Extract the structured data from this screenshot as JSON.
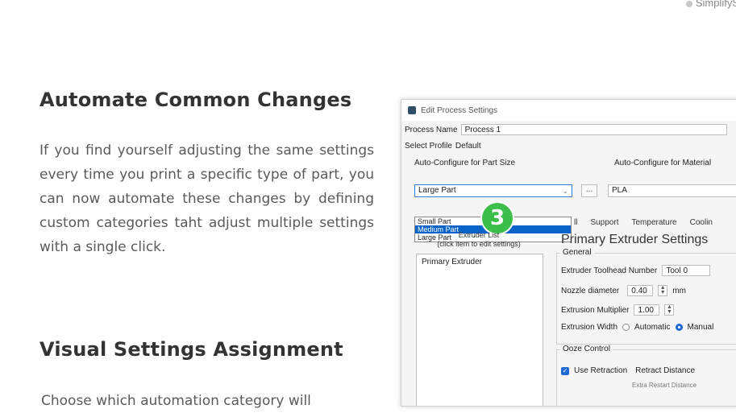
{
  "brand": {
    "text": "SimplifyS"
  },
  "article": {
    "heading1": "Automate Common Changes",
    "paragraph1": "If you find yourself adjusting the same settings every time you print a specific type of part, you can now automate these changes by defining custom categories taht adjust multiple settings with a single click.",
    "heading2": "Visual Settings Assignment",
    "paragraph2": "Choose which automation category will"
  },
  "dialog": {
    "title": "Edit Process Settings",
    "process_name_label": "Process Name",
    "process_name_value": "Process 1",
    "select_profile_label": "Select Profile",
    "select_profile_value": "Default",
    "autoconf_part_label": "Auto-Configure for Part Size",
    "autoconf_part_value": "Large Part",
    "ellipsis_label": "...",
    "autoconf_material_label": "Auto-Configure for Material",
    "autoconf_material_value": "PLA",
    "dropdown_options": [
      "Small Part",
      "Medium Part",
      "Large Part"
    ],
    "dropdown_selected_index": 1,
    "badge": "3",
    "tabs": [
      "ll",
      "Support",
      "Temperature",
      "Coolin"
    ],
    "extruder_list_header": "Extruder List",
    "extruder_list_sub": "(click item to edit settings)",
    "extruder_items": [
      "Primary Extruder"
    ],
    "primary_title": "Primary Extruder Settings",
    "general_legend": "General",
    "toolhead_label": "Extruder Toolhead Number",
    "toolhead_value": "Tool 0",
    "nozzle_label": "Nozzle diameter",
    "nozzle_value": "0.40",
    "nozzle_unit": "mm",
    "multiplier_label": "Extrusion Multiplier",
    "multiplier_value": "1.00",
    "width_label": "Extrusion Width",
    "width_auto": "Automatic",
    "width_manual": "Manual",
    "ooze_legend": "Ooze Control",
    "retraction_label": "Use Retraction",
    "retract_distance_label": "Retract Distance",
    "extra_restart_label": "Extra Restart Distance"
  },
  "colors": {
    "badge": "#3bbf4a",
    "selection": "#0a64c8",
    "accent": "#1e6bd6"
  }
}
